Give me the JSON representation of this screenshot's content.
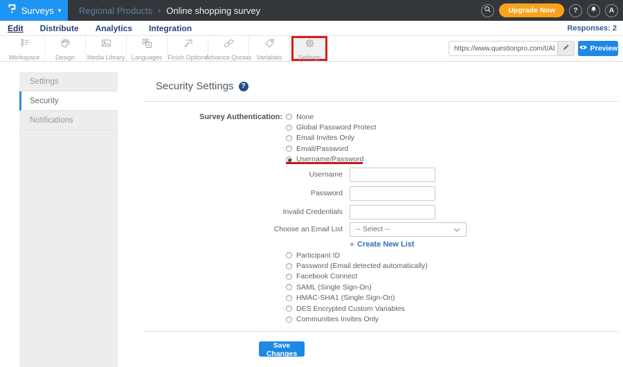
{
  "topbar": {
    "product": "Surveys",
    "caret": "▾",
    "breadcrumb_parent": "Regional Products",
    "breadcrumb_sep": "›",
    "breadcrumb_current": "Online shopping survey",
    "upgrade_label": "Upgrade Now",
    "help_glyph": "?",
    "avatar_initial": "A"
  },
  "nav": {
    "items": [
      {
        "label": "Edit"
      },
      {
        "label": "Distribute"
      },
      {
        "label": "Analytics"
      },
      {
        "label": "Integration"
      }
    ],
    "responses": "Responses: 2"
  },
  "toolbar": {
    "items": [
      {
        "label": "Workspace"
      },
      {
        "label": "Design"
      },
      {
        "label": "Media Library"
      },
      {
        "label": "Languages"
      },
      {
        "label": "Finish Options"
      },
      {
        "label": "Advance Quotas"
      },
      {
        "label": "Variables"
      },
      {
        "label": "Settings"
      }
    ],
    "url_value": "https://www.questionpro.com/t/APNrFZ",
    "preview_label": "Preview"
  },
  "sidebar": {
    "items": [
      {
        "label": "Settings"
      },
      {
        "label": "Security"
      },
      {
        "label": "Notifications"
      }
    ]
  },
  "main": {
    "title": "Security Settings",
    "help_glyph": "?",
    "auth_label": "Survey Authentication:",
    "auth_options_top": [
      "None",
      "Global Password Protect",
      "Email Invites Only",
      "Email/Password",
      "Username/Password"
    ],
    "selected_option": "Username/Password",
    "fields": [
      {
        "label": "Username",
        "value": ""
      },
      {
        "label": "Password",
        "value": ""
      },
      {
        "label": "Invalid Credentials",
        "value": ""
      }
    ],
    "email_list_label": "Choose an Email List",
    "email_list_value": "-- Select --",
    "create_list_plus": "+",
    "create_list_label": "Create New List",
    "auth_options_bottom": [
      "Participant ID",
      "Password (Email detected automatically)",
      "Facebook Connect",
      "SAML (Single Sign-On)",
      "HMAC-SHA1 (Single Sign-On)",
      "DES Encrypted Custom Variables",
      "Communities Invites Only"
    ],
    "save_label": "Save Changes"
  },
  "colors": {
    "brand_blue": "#2094f3",
    "topbar_dark": "#33373c",
    "accent_blue": "#1e88e5",
    "upgrade_orange": "#f9a11c",
    "annotation_red": "#d51a1a"
  }
}
